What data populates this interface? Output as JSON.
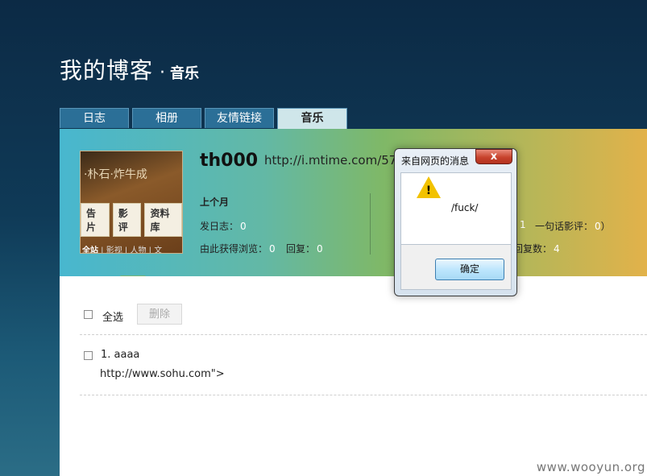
{
  "header": {
    "blog_title": "我的博客",
    "separator": "·",
    "section": "音乐"
  },
  "tabs": [
    {
      "label": "日志"
    },
    {
      "label": "相册"
    },
    {
      "label": "友情链接"
    },
    {
      "label": "音乐",
      "active": true
    }
  ],
  "profile": {
    "avatar": {
      "script_text": "·朴石·炸牛成",
      "buttons": [
        "告片",
        "影评",
        "资料库"
      ],
      "nav": [
        "全站",
        "影视",
        "人物",
        "文"
      ]
    },
    "username": "th000",
    "home_url": "http://i.mtime.com/578",
    "stats_left": {
      "title": "上个月",
      "posts_label": "发日志：",
      "posts_value": "0",
      "views_label": "由此获得浏览：",
      "views_value": "0",
      "replies_label": "回复：",
      "replies_value": "0"
    },
    "stats_right": {
      "fragment_value": "1",
      "oneline_label": "一句话影评：",
      "oneline_value": "0",
      "close_paren": "）",
      "replycount_label": "回复数：",
      "replycount_value": "4"
    }
  },
  "list": {
    "select_all_label": "全选",
    "delete_label": "删除",
    "entries": [
      {
        "title": "1. aaaa",
        "url_text": "http://www.sohu.com\">"
      }
    ]
  },
  "dialog": {
    "title": "来自网页的消息",
    "close_glyph": "x",
    "message": "/fuck/",
    "ok_label": "确定",
    "icon": "warning-icon"
  },
  "watermark": "www.wooyun.org",
  "colors": {
    "tab_bg": "#2b6f97",
    "tab_active_bg": "#cfe6ea",
    "stat_value": "#ffffff",
    "dialog_close": "#c7432d"
  }
}
